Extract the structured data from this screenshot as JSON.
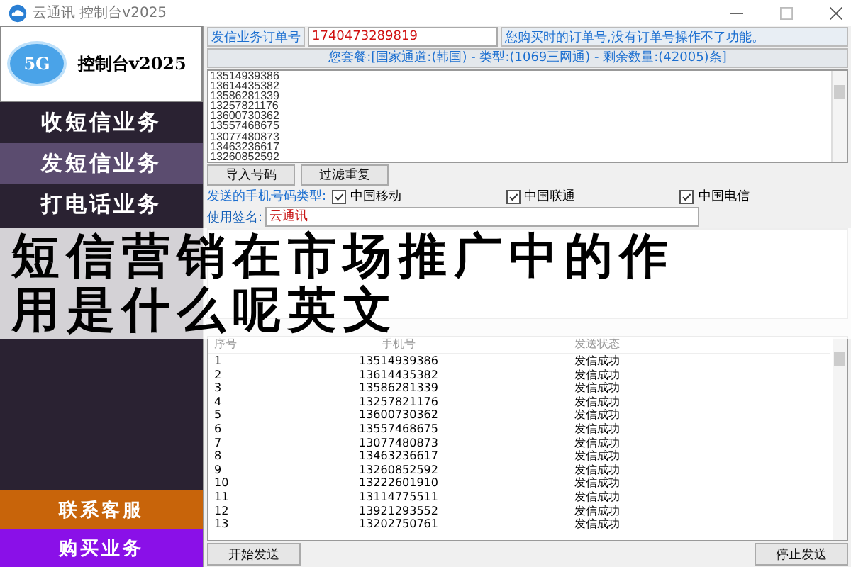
{
  "window": {
    "title": "云通讯 控制台v2025"
  },
  "sidebar": {
    "logo_badge": "5G",
    "logo_text": "控制台v2025",
    "menu": [
      {
        "label": "收短信业务",
        "selected": false
      },
      {
        "label": "发短信业务",
        "selected": true
      },
      {
        "label": "打电话业务",
        "selected": false
      }
    ],
    "actions": [
      {
        "label": "联系客服",
        "color": "#c8640a"
      },
      {
        "label": "购买业务",
        "color": "#8a10e8"
      }
    ]
  },
  "order": {
    "label": "发信业务订单号",
    "value": "1740473289819",
    "note": "您购买时的订单号,没有订单号操作不了功能。"
  },
  "package": "您套餐:[国家通道:(韩国) - 类型:(1069三网通) - 剩余数量:(42005)条]",
  "numbers": [
    "13514939386",
    "13614435382",
    "13586281339",
    "13257821176",
    "13600730362",
    "13557468675",
    "13077480873",
    "13463236617",
    "13260852592"
  ],
  "buttons": [
    "导入号码",
    "过滤重复"
  ],
  "carriers": {
    "label": "发送的手机号码类型:",
    "items": [
      {
        "label": "中国移动",
        "checked": true
      },
      {
        "label": "中国联通",
        "checked": true
      },
      {
        "label": "中国电信",
        "checked": true
      }
    ]
  },
  "signature": {
    "label": "使用签名:",
    "value": "云通讯"
  },
  "overlay_title": "短信营销在市场推广中的作用是什么呢英文",
  "table": {
    "columns": [
      "序号",
      "手机号",
      "发送状态"
    ],
    "rows": [
      [
        "1",
        "13514939386",
        "发信成功"
      ],
      [
        "2",
        "13614435382",
        "发信成功"
      ],
      [
        "3",
        "13586281339",
        "发信成功"
      ],
      [
        "4",
        "13257821176",
        "发信成功"
      ],
      [
        "5",
        "13600730362",
        "发信成功"
      ],
      [
        "6",
        "13557468675",
        "发信成功"
      ],
      [
        "7",
        "13077480873",
        "发信成功"
      ],
      [
        "8",
        "13463236617",
        "发信成功"
      ],
      [
        "9",
        "13260852592",
        "发信成功"
      ],
      [
        "10",
        "13222601910",
        "发信成功"
      ],
      [
        "11",
        "13114775511",
        "发信成功"
      ],
      [
        "12",
        "13921293552",
        "发信成功"
      ],
      [
        "13",
        "13202750761",
        "发信成功"
      ]
    ]
  },
  "footer_buttons": [
    "开始发送",
    "停止发送"
  ]
}
